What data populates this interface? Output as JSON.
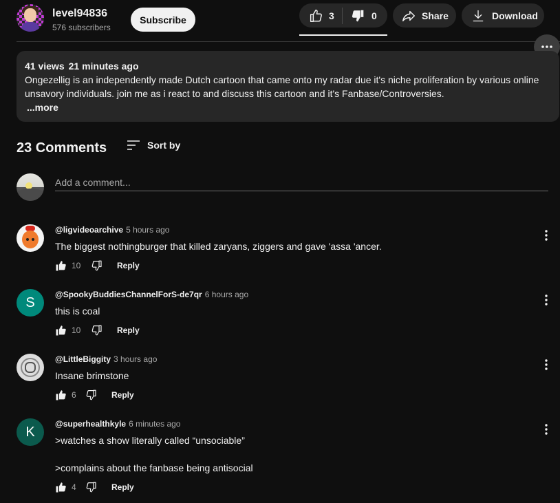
{
  "channel": {
    "name": "level94836",
    "subscribers": "576 subscribers",
    "subscribe_label": "Subscribe"
  },
  "actions": {
    "likes": "3",
    "dislikes": "0",
    "share_label": "Share",
    "download_label": "Download"
  },
  "description": {
    "views": "41 views",
    "time": "21 minutes ago",
    "text": "Ongezellig is an independently made Dutch cartoon that came onto my radar due it's niche proliferation by various online unsavory individuals. join me as i react to and discuss this cartoon and it's Fanbase/Controversies.",
    "more_label": "...more"
  },
  "comments_section": {
    "count_label": "23 Comments",
    "sort_label": "Sort by",
    "add_placeholder": "Add a comment..."
  },
  "comments": [
    {
      "author": "@ligvideoarchive",
      "time": "5 hours ago",
      "lines": [
        "The biggest nothingburger that killed zaryans, ziggers and gave 'assa 'ancer."
      ],
      "likes": "10",
      "reply_label": "Reply"
    },
    {
      "author": "@SpookyBuddiesChannelForS-de7qr",
      "time": "6 hours ago",
      "avatar_letter": "S",
      "lines": [
        "this is coal"
      ],
      "likes": "10",
      "reply_label": "Reply"
    },
    {
      "author": "@LittleBiggity",
      "time": "3 hours ago",
      "lines": [
        "Insane brimstone"
      ],
      "likes": "6",
      "reply_label": "Reply"
    },
    {
      "author": "@superhealthkyle",
      "time": "6 minutes ago",
      "avatar_letter": "K",
      "lines": [
        ">watches a show literally called “unsociable”",
        "",
        ">complains about the fanbase being antisocial"
      ],
      "likes": "4",
      "reply_label": "Reply"
    }
  ],
  "icons": {
    "like": "thumbs-up-icon",
    "dislike": "thumbs-down-icon",
    "share": "share-arrow-icon",
    "download": "download-icon",
    "sort": "sort-lines-icon",
    "more": "more-horizontal-icon",
    "comment_menu": "more-vertical-icon"
  },
  "colors": {
    "background": "#0f0f0f",
    "pill": "#272727",
    "subscribe_bg": "#f1f1f1",
    "avatar_s": "#00897b",
    "avatar_k": "#0b5a4d"
  }
}
